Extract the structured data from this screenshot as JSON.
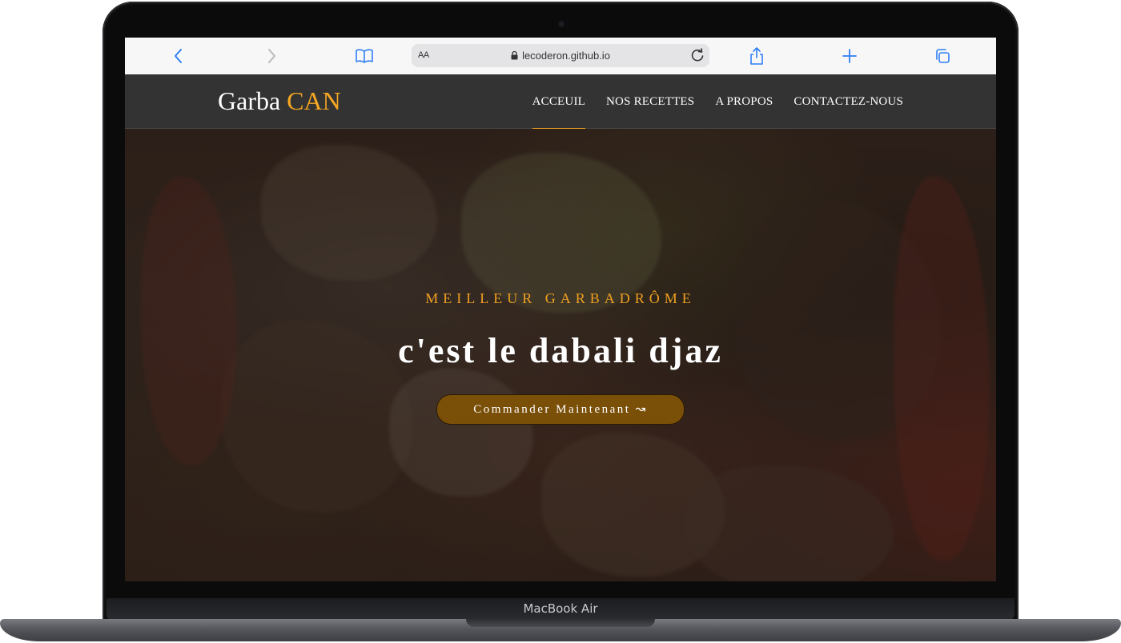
{
  "device": {
    "model_label": "MacBook Air"
  },
  "browser": {
    "text_size_label": "AA",
    "url": "lecoderon.github.io",
    "icons": [
      "back-chevron-icon",
      "forward-chevron-icon",
      "bookmarks-book-icon",
      "lock-icon",
      "reload-icon",
      "share-icon",
      "plus-icon",
      "tabs-icon"
    ]
  },
  "site": {
    "brand": {
      "main": "Garba ",
      "accent": "CAN"
    },
    "nav": [
      {
        "label": "ACCEUIL",
        "active": true
      },
      {
        "label": "NOS RECETTES",
        "active": false
      },
      {
        "label": "A PROPOS",
        "active": false
      },
      {
        "label": "CONTACTEZ-NOUS",
        "active": false
      }
    ],
    "hero": {
      "kicker": "MEILLEUR GARBADRÔME",
      "headline": "c'est le dabali djaz",
      "cta_label": "Commander Maintenant ↝"
    },
    "colors": {
      "accent": "#f5a623",
      "nav_bg": "#333333",
      "cta_bg": "#7a4f08"
    }
  }
}
